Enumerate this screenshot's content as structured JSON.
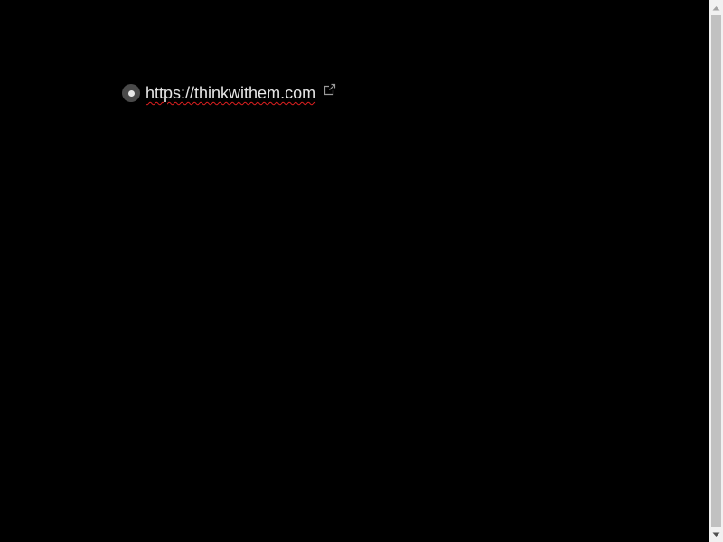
{
  "outline": {
    "item_text": "https://thinkwithem.com",
    "bullet_icon": "bullet-dot-icon",
    "link_icon": "external-link-icon"
  },
  "colors": {
    "background": "#000000",
    "text": "#e6e6e6",
    "spellcheck_underline": "#e02020",
    "bullet_bg": "#4a4a4a",
    "scrollbar_track": "#f1f1f1",
    "scrollbar_thumb": "#c1c1c1"
  }
}
